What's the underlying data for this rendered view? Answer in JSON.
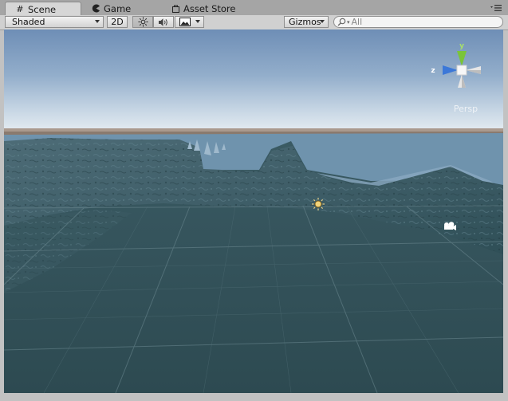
{
  "tabs": [
    {
      "label": "Scene",
      "icon": "grid-icon",
      "active": true
    },
    {
      "label": "Game",
      "icon": "pacman-icon",
      "active": false
    },
    {
      "label": "Asset Store",
      "icon": "bag-icon",
      "active": false
    }
  ],
  "toolbar": {
    "shading_mode": "Shaded",
    "mode_2d": "2D",
    "lighting_icon": "sun-icon",
    "audio_icon": "speaker-icon",
    "effects_icon": "image-icon",
    "gizmos_label": "Gizmos",
    "search_placeholder": "All"
  },
  "gizmo": {
    "y_label": "y",
    "z_label": "z",
    "projection_label": "Persp"
  },
  "scene": {
    "sky_top": "#6f8fb6",
    "sky_horizon": "#d4e0ea",
    "ground_color": "#2e4b52",
    "water_color": "#6b8faa"
  }
}
